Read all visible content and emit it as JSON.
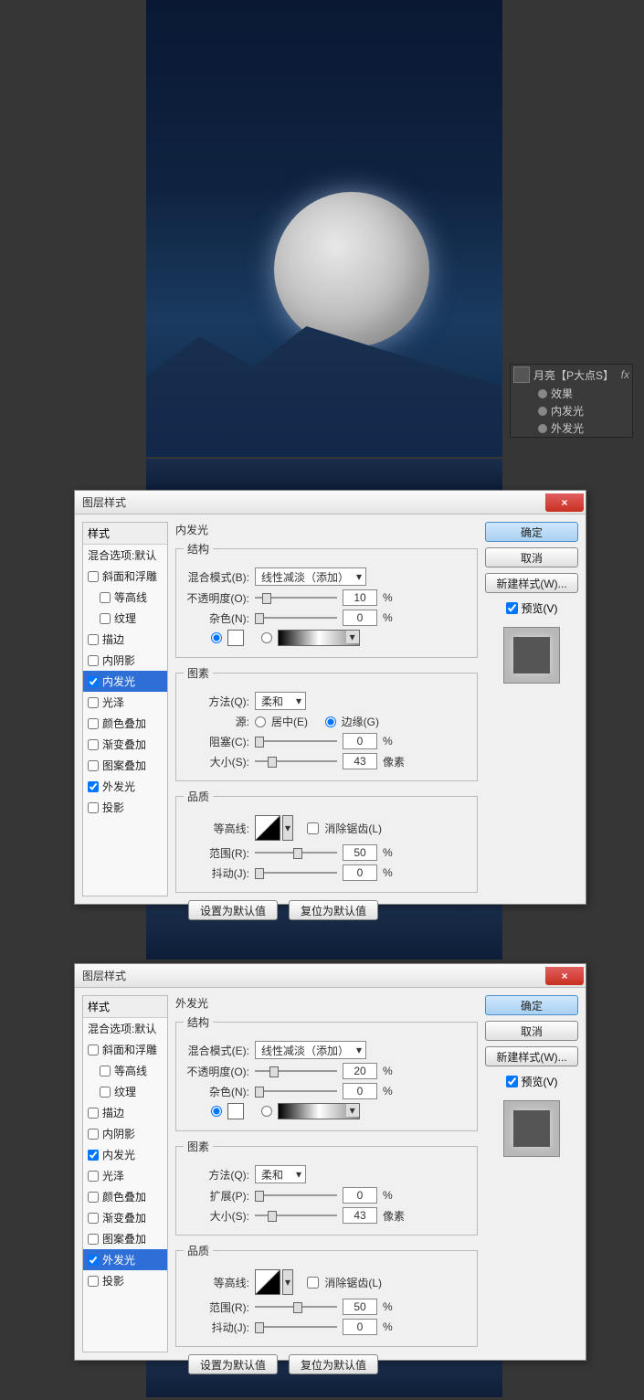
{
  "layer_panel": {
    "layer_name": "月亮【P大点S】",
    "fx": "fx",
    "effects": "效果",
    "inner_glow": "内发光",
    "outer_glow": "外发光"
  },
  "dialog_title": "图层样式",
  "close": "×",
  "styles": {
    "header": "样式",
    "blend_default": "混合选项:默认",
    "bevel": "斜面和浮雕",
    "contour": "等高线",
    "texture": "纹理",
    "stroke": "描边",
    "inner_shadow": "内阴影",
    "inner_glow": "内发光",
    "satin": "光泽",
    "color_overlay": "颜色叠加",
    "gradient_overlay": "渐变叠加",
    "pattern_overlay": "图案叠加",
    "outer_glow": "外发光",
    "drop_shadow": "投影"
  },
  "buttons": {
    "ok": "确定",
    "cancel": "取消",
    "new_style": "新建样式(W)...",
    "preview": "预览(V)",
    "set_default": "设置为默认值",
    "reset_default": "复位为默认值"
  },
  "inner": {
    "title": "内发光",
    "structure": "结构",
    "blend_mode_lbl": "混合模式(B):",
    "blend_mode_val": "线性减淡（添加）",
    "opacity_lbl": "不透明度(O):",
    "opacity_val": "10",
    "pct": "%",
    "noise_lbl": "杂色(N):",
    "noise_val": "0",
    "elements": "图素",
    "technique_lbl": "方法(Q):",
    "technique_val": "柔和",
    "source_lbl": "源:",
    "source_center": "居中(E)",
    "source_edge": "边缘(G)",
    "choke_lbl": "阻塞(C):",
    "choke_val": "0",
    "size_lbl": "大小(S):",
    "size_val": "43",
    "px": "像素",
    "quality": "品质",
    "contour_lbl": "等高线:",
    "anti_alias": "消除锯齿(L)",
    "range_lbl": "范围(R):",
    "range_val": "50",
    "jitter_lbl": "抖动(J):",
    "jitter_val": "0"
  },
  "outer": {
    "title": "外发光",
    "structure": "结构",
    "blend_mode_lbl": "混合模式(E):",
    "blend_mode_val": "线性减淡（添加）",
    "opacity_lbl": "不透明度(O):",
    "opacity_val": "20",
    "pct": "%",
    "noise_lbl": "杂色(N):",
    "noise_val": "0",
    "elements": "图素",
    "technique_lbl": "方法(Q):",
    "technique_val": "柔和",
    "spread_lbl": "扩展(P):",
    "spread_val": "0",
    "size_lbl": "大小(S):",
    "size_val": "43",
    "px": "像素",
    "quality": "品质",
    "contour_lbl": "等高线:",
    "anti_alias": "消除锯齿(L)",
    "range_lbl": "范围(R):",
    "range_val": "50",
    "jitter_lbl": "抖动(J):",
    "jitter_val": "0"
  }
}
